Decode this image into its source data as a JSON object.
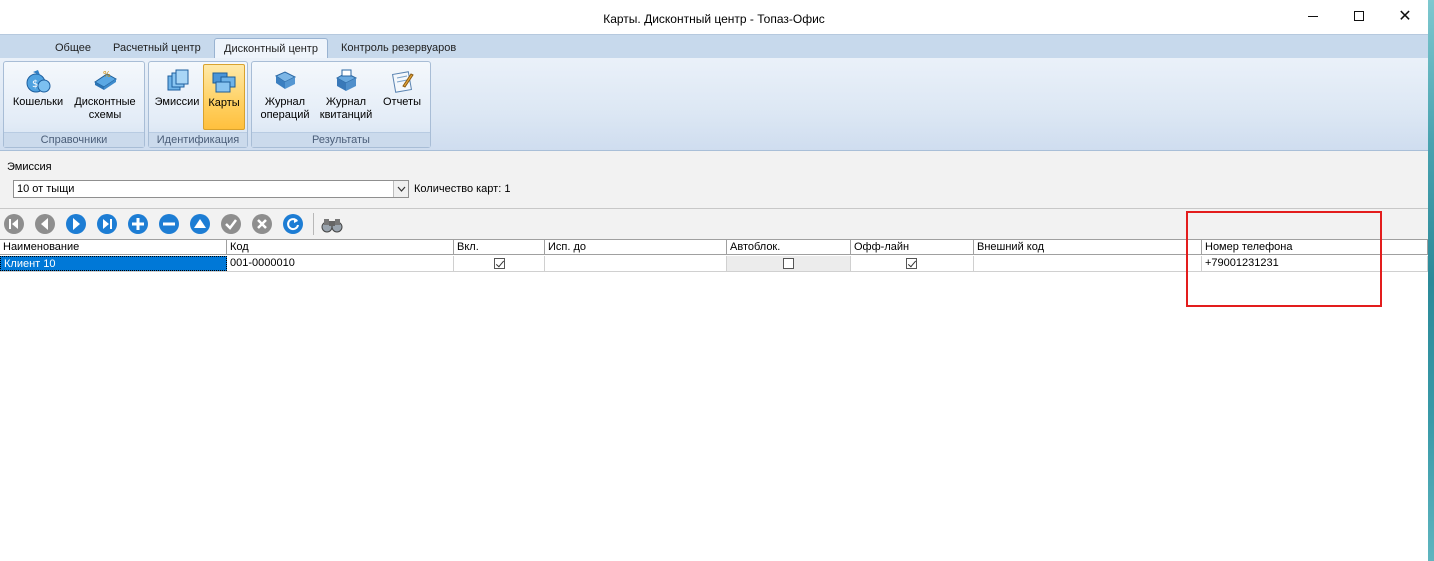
{
  "window": {
    "title": "Карты. Дисконтный центр - Топаз-Офис",
    "minimize_symbol": "—",
    "close_symbol": "✕"
  },
  "ribbon_tabs": [
    {
      "label": "Общее",
      "active": false
    },
    {
      "label": "Расчетный центр",
      "active": false
    },
    {
      "label": "Дисконтный центр",
      "active": true
    },
    {
      "label": "Контроль резервуаров",
      "active": false
    }
  ],
  "ribbon_groups": [
    {
      "label": "Справочники",
      "buttons": [
        {
          "line1": "Кошельки",
          "line2": "",
          "icon": "wallet-icon"
        },
        {
          "line1": "Дисконтные",
          "line2": "схемы",
          "icon": "discount-schemes-icon"
        }
      ]
    },
    {
      "label": "Идентификация",
      "buttons": [
        {
          "line1": "Эмиссии",
          "line2": "",
          "icon": "emissions-icon"
        },
        {
          "line1": "Карты",
          "line2": "",
          "icon": "cards-icon",
          "active": true
        }
      ]
    },
    {
      "label": "Результаты",
      "buttons": [
        {
          "line1": "Журнал",
          "line2": "операций",
          "icon": "operations-journal-icon"
        },
        {
          "line1": "Журнал",
          "line2": "квитанций",
          "icon": "receipts-journal-icon"
        },
        {
          "line1": "Отчеты",
          "line2": "",
          "icon": "reports-icon"
        }
      ]
    }
  ],
  "emission": {
    "label": "Эмиссия",
    "selected": "10 от тыщи",
    "count_text": "Количество карт: 1"
  },
  "nav_toolbar": [
    "first-record-icon",
    "prev-record-icon",
    "next-record-icon",
    "last-record-icon",
    "add-record-icon",
    "delete-record-icon",
    "edit-record-icon",
    "post-record-icon",
    "cancel-record-icon",
    "refresh-icon",
    "find-binoculars-icon"
  ],
  "grid": {
    "columns": [
      "Наименование",
      "Код",
      "Вкл.",
      "Исп. до",
      "Автоблок.",
      "Офф-лайн",
      "Внешний код",
      "Номер телефона"
    ],
    "rows": [
      {
        "name": "Клиент 10",
        "code": "001-0000010",
        "enabled": true,
        "valid_until": "",
        "autoblock": false,
        "offline": true,
        "external_code": "",
        "phone": "+79001231231"
      }
    ]
  },
  "colors": {
    "selection": "#0078d7",
    "highlight_box": "#e31d1d",
    "ribbon_active": "#ffd061"
  }
}
